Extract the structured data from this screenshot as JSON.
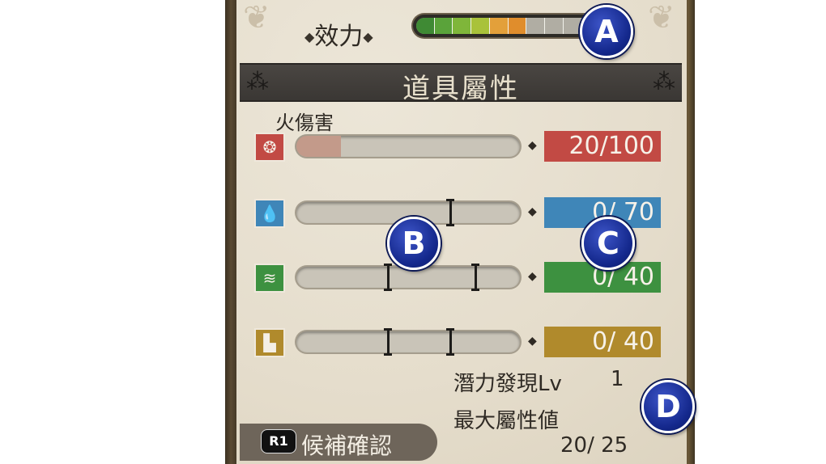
{
  "efficacy": {
    "label": "效力",
    "level": 0.6,
    "segment_colors": [
      "#3f8a34",
      "#5aa33a",
      "#7fb63a",
      "#a9c23a",
      "#e3a03a",
      "#e08d2c",
      "#b0ada3",
      "#b0ada3",
      "#b0ada3",
      "#b0ada3",
      "#b0ada3"
    ]
  },
  "header": {
    "title": "道具屬性"
  },
  "attributes": [
    {
      "label": "火傷害",
      "icon": "fire-icon",
      "color": "#c24a44",
      "value_text": "20/100",
      "value": 20,
      "max": 100,
      "thresholds": []
    },
    {
      "label": "",
      "icon": "water-drop-icon",
      "color": "#3f86b8",
      "value_text": "0/ 70",
      "value": 0,
      "max": 70,
      "thresholds": [
        0.69
      ]
    },
    {
      "label": "",
      "icon": "wind-icon",
      "color": "#3d9140",
      "value_text": "0/ 40",
      "value": 0,
      "max": 40,
      "thresholds": [
        0.41,
        0.8
      ]
    },
    {
      "label": "",
      "icon": "earth-icon",
      "color": "#b08a2c",
      "value_text": "0/ 40",
      "value": 0,
      "max": 40,
      "thresholds": [
        0.41,
        0.69
      ]
    }
  ],
  "potential": {
    "label": "潛力發現Lv",
    "value": "1"
  },
  "max_attr": {
    "label": "最大屬性値",
    "value": "20/ 25"
  },
  "r1_button": {
    "key": "R1",
    "label": "候補確認"
  },
  "markers": {
    "a": "A",
    "b": "B",
    "c": "C",
    "d": "D"
  }
}
